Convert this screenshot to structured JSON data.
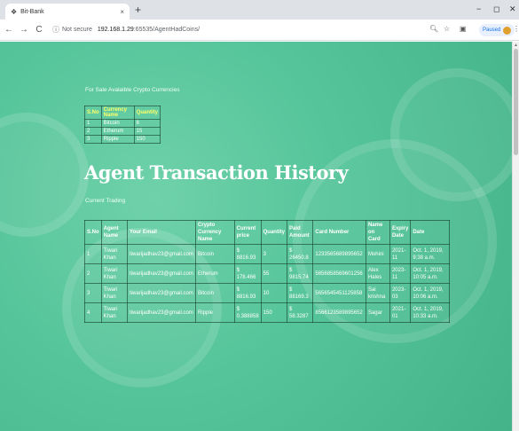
{
  "browser": {
    "tab_title": "Bit-Bank",
    "tab_close": "×",
    "new_tab": "+",
    "address": {
      "security_label": "Not secure",
      "host": "192.168.1.29",
      "path": ":65535/AgentHadCoins/"
    },
    "profile_status": "Paused",
    "window_controls": [
      "−",
      "◻",
      "✕"
    ]
  },
  "sale_section": {
    "title": "For Sale Avalaible Crypto Currencies",
    "headers": [
      "S.No",
      "Currency Name",
      "Quantity"
    ],
    "rows": [
      [
        "1",
        "Bitcoin",
        "6"
      ],
      [
        "2",
        "Etherum",
        "15"
      ],
      [
        "3",
        "Ripple",
        "150"
      ]
    ]
  },
  "history": {
    "heading": "Agent Transaction History",
    "subheading": "Current Trading",
    "headers": [
      "S.No",
      "Agent Name",
      "Your Email",
      "Crypto Currency Name",
      "Current price",
      "Quantity",
      "Paid Amount",
      "Card Number",
      "Name on Card",
      "Expiry Date",
      "Date"
    ],
    "rows": [
      [
        "1",
        "Tiwari Khan",
        "tiwarijadhav23@gmail.com",
        "Bitcoin",
        "$ 8816.93",
        "3",
        "$ 26450.8",
        "1233565689895652",
        "Mohini",
        "2021-11",
        "Oct. 1, 2019, 9:38 a.m."
      ],
      [
        "2",
        "Tiwari Khan",
        "tiwarijadhav23@gmail.com",
        "Etherum",
        "$ 178.466",
        "55",
        "$ 9815.74",
        "5656858569601256",
        "Alex Hales",
        "2023-11",
        "Oct. 1, 2019, 10:05 a.m."
      ],
      [
        "3",
        "Tiwari Khan",
        "tiwarijadhav23@gmail.com",
        "Bitcoin",
        "$ 8816.93",
        "10",
        "$ 88169.3",
        "5656545451125858",
        "Sai krishna",
        "2023-03",
        "Oct. 1, 2019, 10:06 a.m."
      ],
      [
        "4",
        "Tiwari Khan",
        "tiwarijadhav23@gmail.com",
        "Ripple",
        "$ 0.388858",
        "150",
        "$ 58.3287",
        "8566123589895652",
        "Sagar",
        "2021-01",
        "Oct. 1, 2019, 10:33 a.m."
      ]
    ]
  }
}
